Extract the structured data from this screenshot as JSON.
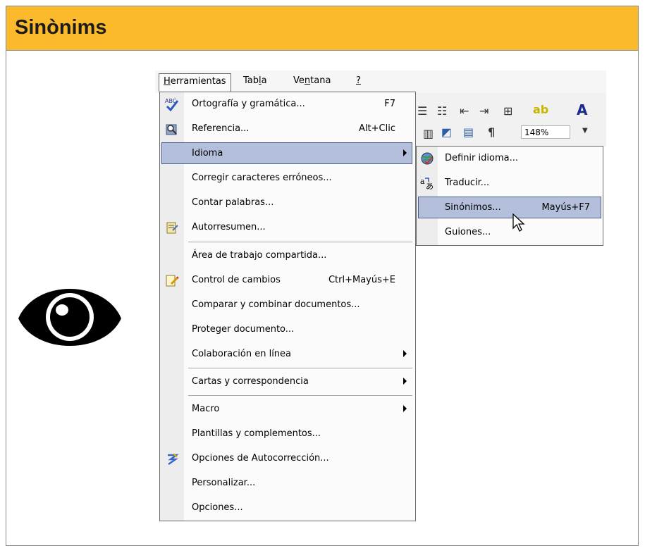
{
  "header": {
    "title": "Sinònims"
  },
  "colors": {
    "header_bg": "#fbb92c",
    "highlight_bg": "#b4bfdb",
    "highlight_border": "#4b5d8f"
  },
  "menubar": {
    "items": [
      "Herramientas",
      "Tabla",
      "Ventana",
      "?"
    ]
  },
  "toolbar": {
    "zoom": "148%"
  },
  "menu": {
    "items": [
      {
        "label": "Ortografía y gramática...",
        "shortcut": "F7",
        "icon": "spelling-icon"
      },
      {
        "label": "Referencia...",
        "shortcut": "Alt+Clic",
        "icon": "research-icon"
      },
      {
        "label": "Idioma",
        "submenu": true
      },
      {
        "label": "Corregir caracteres erróneos..."
      },
      {
        "label": "Contar palabras..."
      },
      {
        "label": "Autorresumen...",
        "icon": "autosummarize-icon"
      },
      {
        "label": "Área de trabajo compartida..."
      },
      {
        "label": "Control de cambios",
        "shortcut": "Ctrl+Mayús+E",
        "icon": "track-changes-icon"
      },
      {
        "label": "Comparar y combinar documentos..."
      },
      {
        "label": "Proteger documento..."
      },
      {
        "label": "Colaboración en línea",
        "submenu": true
      },
      {
        "label": "Cartas y correspondencia",
        "submenu": true
      },
      {
        "label": "Macro",
        "submenu": true
      },
      {
        "label": "Plantillas y complementos..."
      },
      {
        "label": "Opciones de Autocorrección...",
        "icon": "autocorrect-icon"
      },
      {
        "label": "Personalizar..."
      },
      {
        "label": "Opciones..."
      }
    ]
  },
  "submenu": {
    "items": [
      {
        "label": "Definir idioma...",
        "icon": "set-language-icon"
      },
      {
        "label": "Traducir...",
        "icon": "translate-icon"
      },
      {
        "label": "Sinónimos...",
        "shortcut": "Mayús+F7"
      },
      {
        "label": "Guiones..."
      }
    ]
  }
}
